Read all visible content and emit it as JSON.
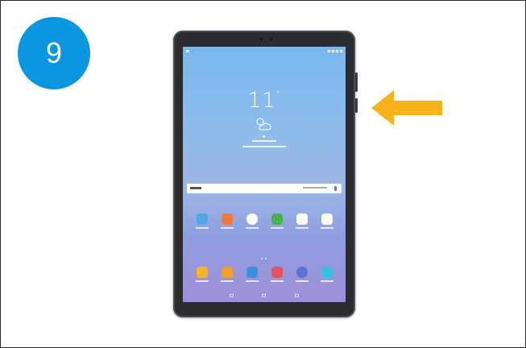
{
  "step": {
    "number": "9",
    "color": "#0b96e0"
  },
  "arrow": {
    "color": "#f7b21c",
    "direction": "left",
    "points_to": "side-power-key"
  },
  "tablet": {
    "clock_hours": "11",
    "clock_suffix": "°",
    "home_apps_row1": [
      "samsung-folder",
      "notes",
      "clock",
      "gallery-plant",
      "play-store",
      "more-apps"
    ],
    "home_apps_row2": [
      "my-files",
      "gallery",
      "camera",
      "email",
      "internet",
      "calendar"
    ]
  }
}
